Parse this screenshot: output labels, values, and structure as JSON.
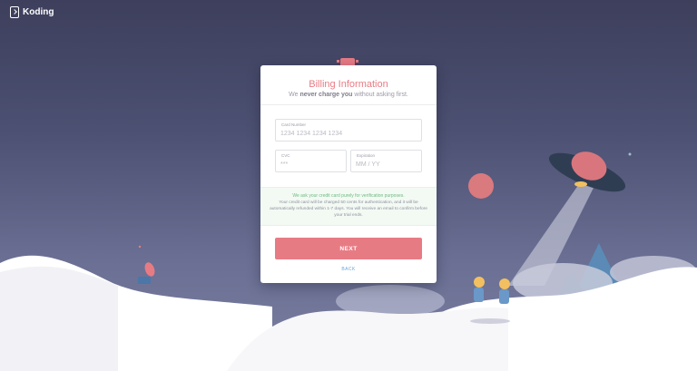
{
  "brand": {
    "name": "Koding"
  },
  "billing": {
    "title": "Billing Information",
    "subtitle_pre": "We ",
    "subtitle_bold": "never charge you",
    "subtitle_post": " without asking first."
  },
  "form": {
    "card_number": {
      "label": "Card Number",
      "placeholder": "1234 1234 1234 1234"
    },
    "cvc": {
      "label": "CVC",
      "placeholder": "***"
    },
    "expiration": {
      "label": "Expiration",
      "placeholder": "MM / YY"
    }
  },
  "notice": {
    "line1": "We ask your credit card purely for verification purposes.",
    "line2": "Your credit card will be charged 50 cents for authentication, and it will be automatically refunded within 1-7 days. You will receive an email to confirm before your trial ends."
  },
  "actions": {
    "next": "NEXT",
    "back": "BACK"
  },
  "colors": {
    "accent": "#e77b84",
    "link": "#6fa7d8",
    "notice_text": "#6dbb7f",
    "background": "#4c5072"
  }
}
